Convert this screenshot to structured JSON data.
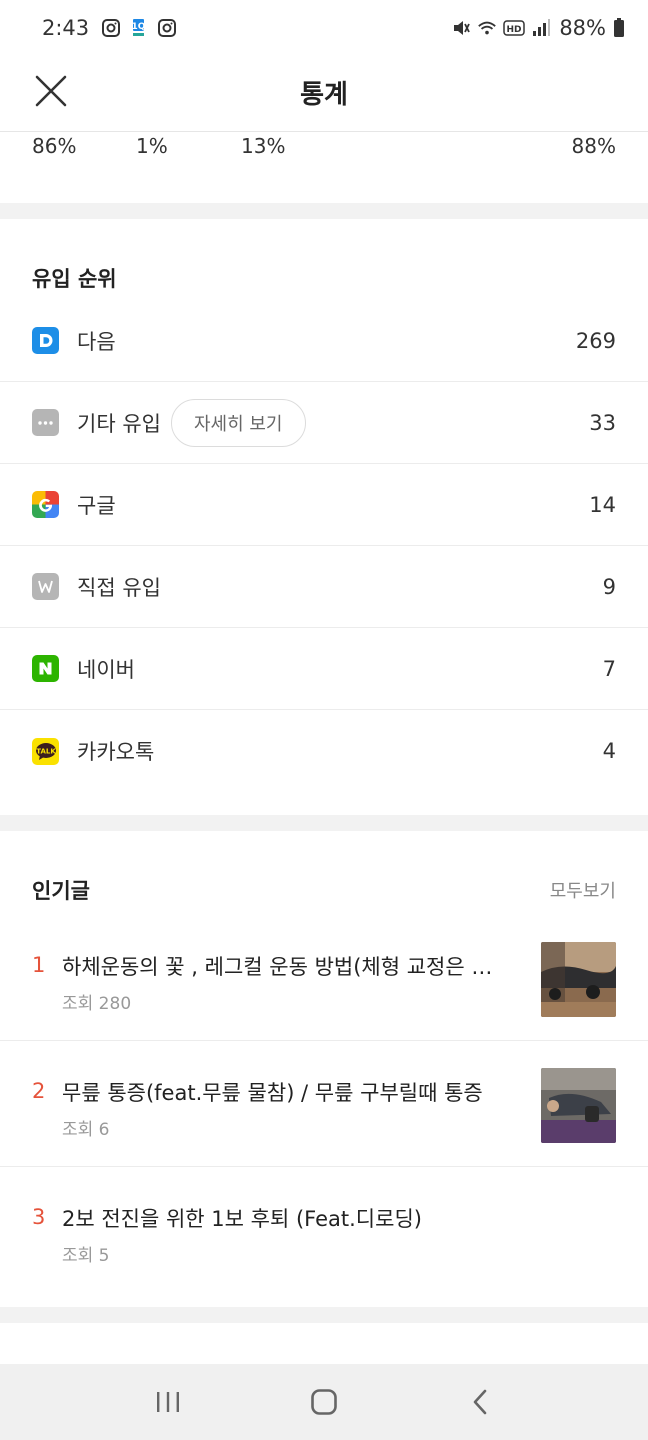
{
  "status_bar": {
    "time": "2:43",
    "battery": "88%",
    "icons": [
      "instagram-icon",
      "app-badge-icon",
      "instagram-icon",
      "mute-icon",
      "wifi-icon",
      "hd-icon",
      "signal-icon",
      "battery-icon"
    ]
  },
  "header": {
    "title": "통계",
    "close_icon": "close-icon"
  },
  "stats": {
    "values": [
      "86%",
      "1%",
      "13%",
      "88%"
    ]
  },
  "inflow": {
    "title": "유입 순위",
    "detail_label": "자세히 보기",
    "items": [
      {
        "label": "다음",
        "count": "269",
        "icon": "daum-icon",
        "icon_text": "D",
        "color": "#1d8ee7"
      },
      {
        "label": "기타 유입",
        "count": "33",
        "icon": "more-icon",
        "icon_text": "···",
        "color": "#b5b5b5"
      },
      {
        "label": "구글",
        "count": "14",
        "icon": "google-icon",
        "icon_text": "G",
        "color": "#ea4335"
      },
      {
        "label": "직접 유입",
        "count": "9",
        "icon": "direct-icon",
        "icon_text": "W",
        "color": "#b5b5b5"
      },
      {
        "label": "네이버",
        "count": "7",
        "icon": "naver-icon",
        "icon_text": "N",
        "color": "#2db400"
      },
      {
        "label": "카카오톡",
        "count": "4",
        "icon": "kakaotalk-icon",
        "icon_text": "TALK",
        "color": "#fae100"
      }
    ]
  },
  "popular": {
    "title": "인기글",
    "see_all": "모두보기",
    "posts": [
      {
        "rank": "1",
        "title": "하체운동의 꽃 , 레그컬 운동 방법(체형 교정은 …",
        "views": "조회 280",
        "has_thumb": true
      },
      {
        "rank": "2",
        "title": "무릎 통증(feat.무릎 물참) / 무릎 구부릴때 통증",
        "views": "조회 6",
        "has_thumb": true
      },
      {
        "rank": "3",
        "title": "2보 전진을 위한 1보 후퇴 (Feat.디로딩)",
        "views": "조회 5",
        "has_thumb": false
      }
    ]
  },
  "nav": {
    "icons": [
      "recent-apps-icon",
      "home-icon",
      "back-icon"
    ]
  }
}
